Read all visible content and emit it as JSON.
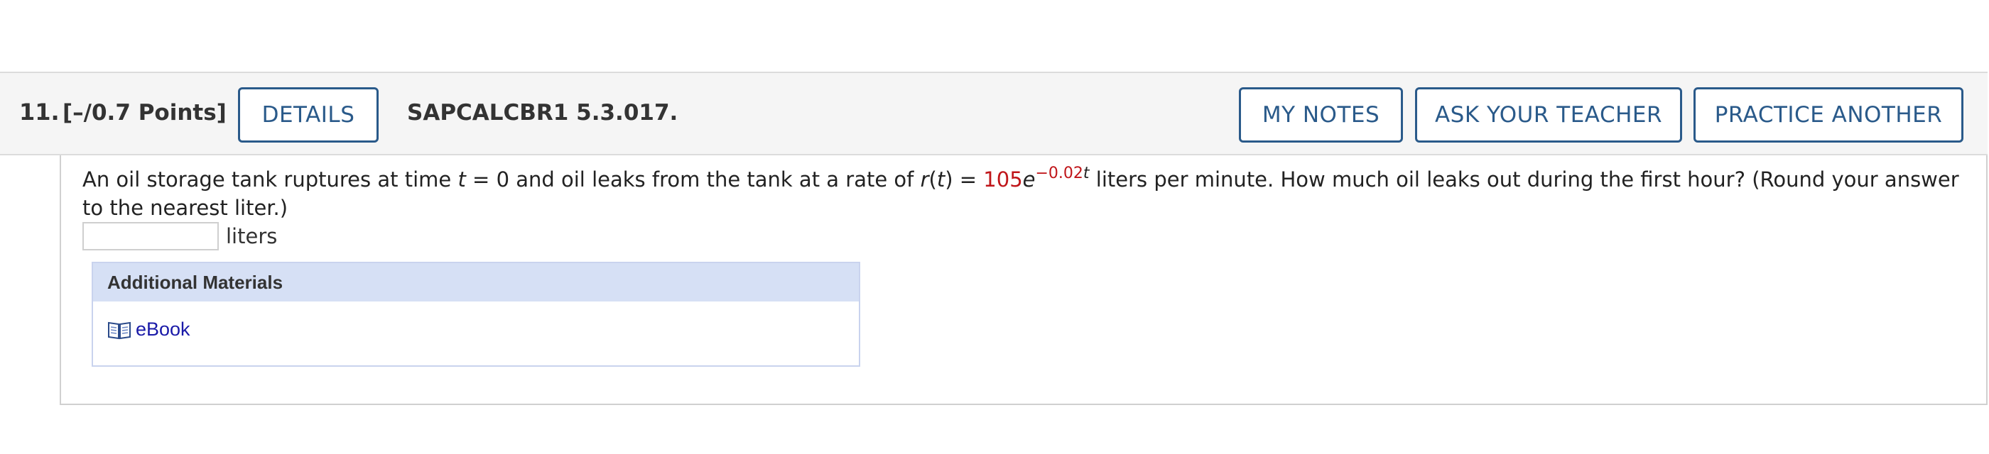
{
  "question": {
    "number": "11.",
    "points": "[–/0.7 Points]",
    "code": "SAPCALCBR1 5.3.017."
  },
  "buttons": {
    "details": "DETAILS",
    "my_notes": "MY NOTES",
    "ask_teacher": "ASK YOUR TEACHER",
    "practice_another": "PRACTICE ANOTHER"
  },
  "prompt": {
    "part1": "An oil storage tank ruptures at time ",
    "var_t": "t",
    "part2": " = 0 and oil leaks from the tank at a rate of ",
    "func_r": "r",
    "paren_open": "(",
    "func_t": "t",
    "paren_close": ")",
    "equals": " = ",
    "coef": "105",
    "base": "e",
    "exponent_num": "−0.02",
    "exponent_var": "t",
    "part3": " liters per minute. How much oil leaks out during the first hour? (Round your answer to the nearest liter.)"
  },
  "answer": {
    "value": "",
    "unit": "liters"
  },
  "materials": {
    "header": "Additional Materials",
    "ebook_label": "eBook",
    "icon": "book-icon"
  },
  "colors": {
    "button_border": "#2a5a8a",
    "highlight_red": "#c0161a",
    "materials_header_bg": "#d6e0f5",
    "link_blue": "#1a1aa8"
  }
}
